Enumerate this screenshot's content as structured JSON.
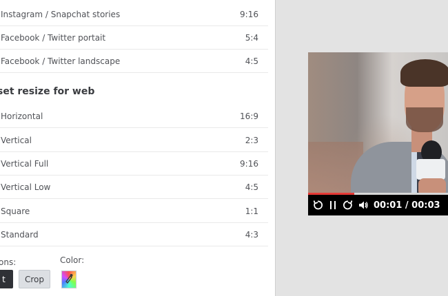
{
  "presets_top": [
    {
      "label": "Instagram / Snapchat stories",
      "ratio": "9:16"
    },
    {
      "label": "Facebook / Twitter portait",
      "ratio": "5:4"
    },
    {
      "label": "Facebook / Twitter landscape",
      "ratio": "4:5"
    }
  ],
  "web_section": {
    "title": "set resize for web",
    "items": [
      {
        "label": "Horizontal",
        "ratio": "16:9"
      },
      {
        "label": "Vertical",
        "ratio": "2:3"
      },
      {
        "label": "Vertical Full",
        "ratio": "9:16"
      },
      {
        "label": "Vertical Low",
        "ratio": "4:5"
      },
      {
        "label": "Square",
        "ratio": "1:1"
      },
      {
        "label": "Standard",
        "ratio": "4:3"
      }
    ]
  },
  "options": {
    "label": "ons:",
    "fit_button": "t",
    "crop_button": "Crop",
    "color_label": "Color:",
    "color_icon": "color-picker-icon"
  },
  "player": {
    "time": "00:01 / 00:03",
    "progress": 0.33,
    "icons": [
      "replay-icon",
      "pause-icon",
      "forward-icon",
      "volume-icon"
    ],
    "accent": "#e53935"
  }
}
